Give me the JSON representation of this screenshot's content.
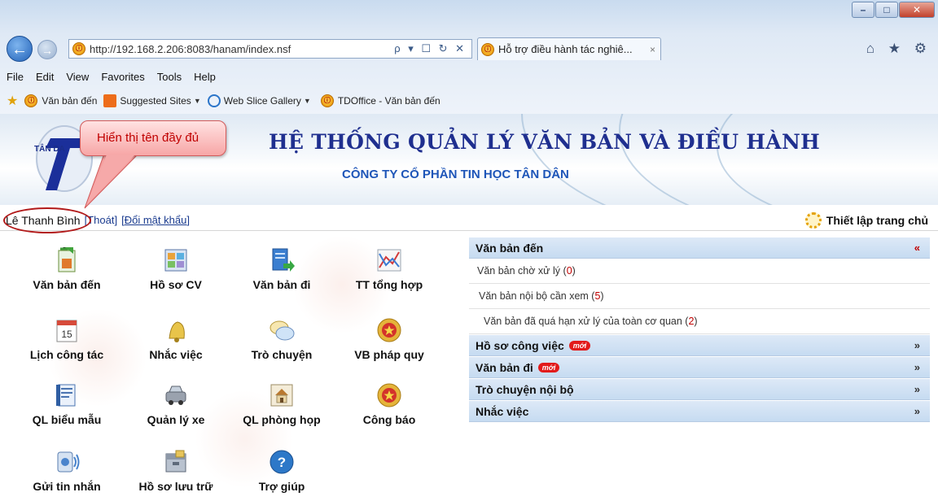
{
  "browser": {
    "url": "http://192.168.2.206:8083/hanam/index.nsf",
    "tab_title": "Hỗ trợ điều hành tác nghiê...",
    "tab_close": "×",
    "address_tools": "ρ ▾ ☐ ↻ ✕",
    "right_icons": "⌂ ★ ⚙",
    "window_buttons": {
      "minimize": "–",
      "restore": "□",
      "close": "✕"
    }
  },
  "menu": {
    "items": [
      "File",
      "Edit",
      "View",
      "Favorites",
      "Tools",
      "Help"
    ]
  },
  "favorites": {
    "items": [
      {
        "label": "Văn bản đến",
        "icon": "site-icon"
      },
      {
        "label": "Suggested Sites",
        "icon": "suggested-sites-icon",
        "dropdown": true
      },
      {
        "label": "Web Slice Gallery",
        "icon": "ie-icon",
        "dropdown": true
      },
      {
        "label": "TDOffice - Văn bản đến",
        "icon": "site-icon"
      }
    ]
  },
  "banner": {
    "logo_text": "TÂN DA",
    "title": "HỆ THỐNG QUẢN LÝ VĂN BẢN VÀ ĐIỀU HÀNH",
    "subtitle": "CÔNG TY CỔ PHẦN TIN HỌC TÂN DÂN"
  },
  "callout": {
    "text": "Hiển thị tên đầy đủ"
  },
  "user": {
    "name": "Lê Thanh Bình",
    "logout": "Thoát",
    "change_password": "Đổi mật khẩu",
    "homepage_setting": "Thiết lập trang chủ"
  },
  "modules": [
    {
      "label": "Văn bản đến",
      "icon": "incoming-document-icon"
    },
    {
      "label": "Hồ sơ CV",
      "icon": "work-file-icon"
    },
    {
      "label": "Văn bản đi",
      "icon": "outgoing-document-icon"
    },
    {
      "label": "TT tổng hợp",
      "icon": "chart-icon"
    },
    {
      "label": "Lịch công tác",
      "icon": "calendar-icon",
      "icon_text": "15"
    },
    {
      "label": "Nhắc việc",
      "icon": "bell-icon"
    },
    {
      "label": "Trò chuyện",
      "icon": "chat-icon"
    },
    {
      "label": "VB pháp quy",
      "icon": "emblem-icon"
    },
    {
      "label": "QL biểu mẫu",
      "icon": "form-icon"
    },
    {
      "label": "Quản lý xe",
      "icon": "car-icon"
    },
    {
      "label": "QL phòng họp",
      "icon": "meeting-room-icon"
    },
    {
      "label": "Công báo",
      "icon": "emblem-icon"
    },
    {
      "label": "Gửi tin nhắn",
      "icon": "send-message-icon"
    },
    {
      "label": "Hồ sơ lưu trữ",
      "icon": "archive-icon"
    },
    {
      "label": "Trợ giúp",
      "icon": "help-icon",
      "icon_text": "?"
    }
  ],
  "panel": {
    "sections": [
      {
        "title": "Văn bản đến",
        "expanded": true,
        "chevron": "«",
        "rows": [
          {
            "text": "Văn bản chờ xử lý",
            "count": "0"
          },
          {
            "text": "Văn bản nội bộ cần xem",
            "count": "5"
          },
          {
            "text": "Văn bản đã quá hạn xử lý của toàn cơ quan",
            "count": "2"
          }
        ]
      },
      {
        "title": "Hồ sơ công việc",
        "badge": "mới",
        "chevron": "»"
      },
      {
        "title": "Văn bản đi",
        "badge": "mới",
        "chevron": "»"
      },
      {
        "title": "Trò chuyện nội bộ",
        "chevron": "»"
      },
      {
        "title": "Nhắc việc",
        "chevron": "»"
      }
    ]
  },
  "colors": {
    "banner_title": "#1f2f8f",
    "banner_subtitle": "#1e55b8",
    "accordion_header": "#c6dbf1",
    "count_red": "#c00000",
    "callout_text": "#c00000",
    "highlight_oval": "#b21a1a"
  }
}
